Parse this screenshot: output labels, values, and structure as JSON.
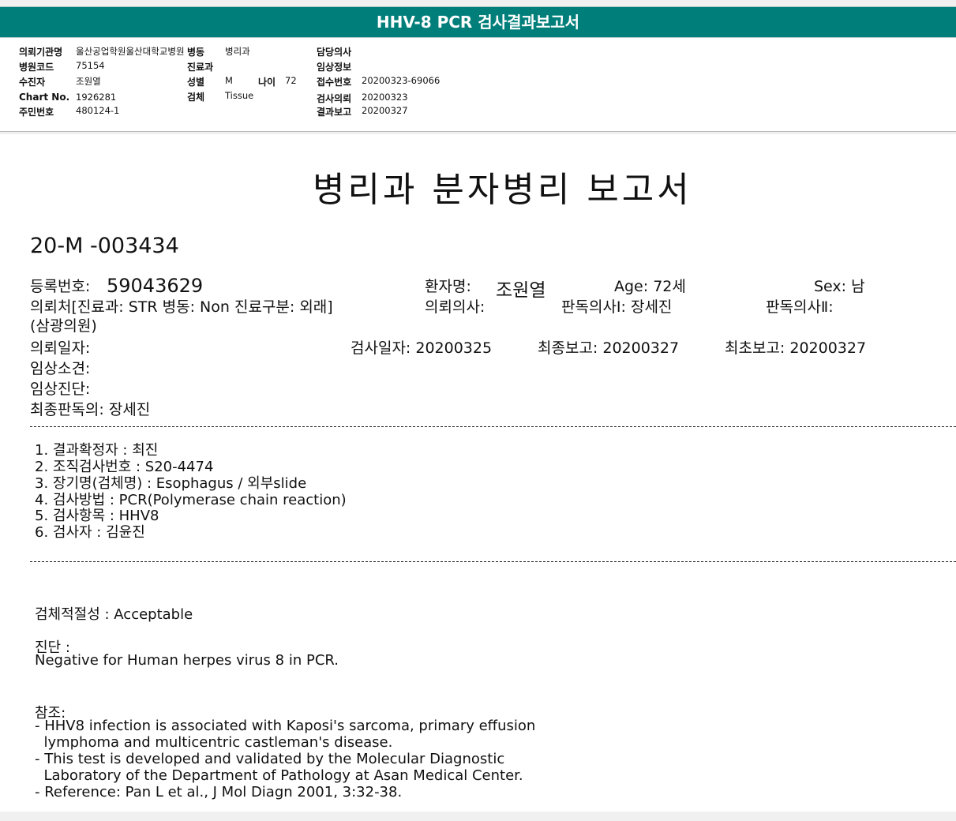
{
  "window": {
    "title": "HHV-8 PCR 검사결과보고서"
  },
  "header": {
    "institution_label": "의뢰기관명",
    "institution_value": "울산공업학원울산대학교병원",
    "ward_label": "병동",
    "ward_value": "병리과",
    "hospital_code_label": "병원코드",
    "hospital_code_value": "75154",
    "dept_label": "진료과",
    "dept_value": "",
    "patient_label": "수진자",
    "patient_value": "조원열",
    "sex_label": "성별",
    "sex_value": "M",
    "age_label": "나이",
    "age_value": "72",
    "chart_label": "Chart No.",
    "chart_value": "1926281",
    "specimen_label": "검체",
    "specimen_value": "Tissue",
    "rrn_label": "주민번호",
    "rrn_value": "480124-1",
    "doctor_label": "담당의사",
    "doctor_value": "",
    "clinical_label": "임상정보",
    "clinical_value": "",
    "receipt_label": "접수번호",
    "receipt_value": "20200323-69066",
    "request_label": "검사의뢰",
    "request_value": "20200323",
    "result_label": "결과보고",
    "result_value": "20200327"
  },
  "report": {
    "title": "병리과 분자병리 보고서",
    "report_no": "20-M -003434",
    "reg_label": "등록번호:",
    "reg_value": "59043629",
    "name_label": "환자명:",
    "name_value": "조원열",
    "age_text": "Age:  72세",
    "sex_text": "Sex:  남",
    "referral_text": "의뢰처[진료과: STR 병동: Non 진료구분: 외래]",
    "referral_doctor": "의뢰의사:",
    "pathologist1": "판독의사Ⅰ: 장세진",
    "pathologist2": "판독의사Ⅱ:",
    "clinic_name": "(삼광의원)",
    "request_date": "의뢰일자:",
    "exam_date": "검사일자: 20200325",
    "final_report": "최종보고: 20200327",
    "first_report": "최초보고: 20200327",
    "clinical_findings": "임상소견:",
    "clinical_diagnosis": "임상진단:",
    "final_reader": "최종판독의: 장세진",
    "items": [
      "1. 결과확정자 :  최진",
      "2. 조직검사번호 : S20-4474",
      "3. 장기명(검체명) : Esophagus / 외부slide",
      "4. 검사방법 : PCR(Polymerase chain reaction)",
      "5. 검사항목 : HHV8",
      "6. 검사자 : 김윤진"
    ],
    "adequacy": "검체적절성 : Acceptable",
    "diagnosis_label": "진단 :",
    "diagnosis_text": "Negative  for  Human  herpes  virus  8  in  PCR.",
    "reference_label": "참조:",
    "reference_lines": [
      "- HHV8 infection is associated with Kaposi's sarcoma, primary effusion",
      "  lymphoma and multicentric castleman's disease.",
      "- This test is developed and validated by the Molecular Diagnostic",
      "  Laboratory of the Department of Pathology at Asan Medical Center.",
      "- Reference: Pan L et al., J Mol Diagn 2001, 3:32-38."
    ]
  },
  "colors": {
    "titlebar": "#007f7a",
    "background": "#f0f0f0"
  }
}
